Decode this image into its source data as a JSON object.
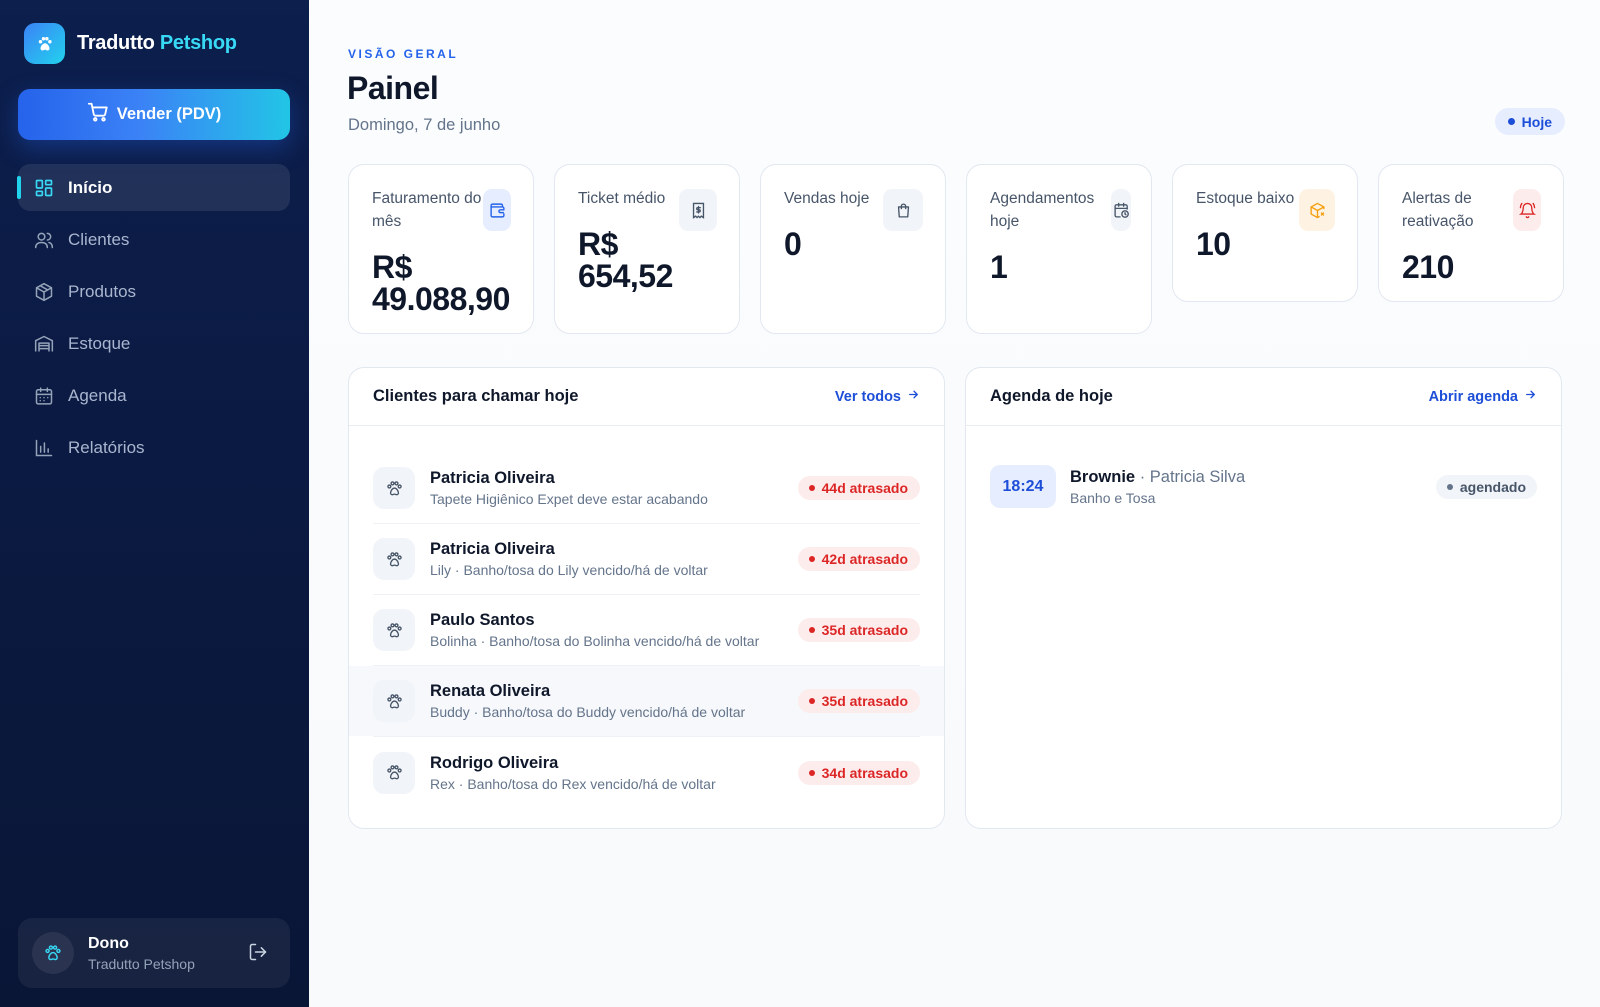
{
  "brand": {
    "name_prefix": "Tradutto",
    "name_accent": "Petshop",
    "logo_icon": "paw-icon"
  },
  "sidebar": {
    "pdv_button_label": "Vender (PDV)",
    "items": [
      {
        "label": "Início",
        "icon": "dashboard-icon",
        "active": true
      },
      {
        "label": "Clientes",
        "icon": "users-icon"
      },
      {
        "label": "Produtos",
        "icon": "box-icon"
      },
      {
        "label": "Estoque",
        "icon": "warehouse-icon"
      },
      {
        "label": "Agenda",
        "icon": "calendar-icon"
      },
      {
        "label": "Relatórios",
        "icon": "bar-chart-icon"
      }
    ],
    "user": {
      "name": "Dono",
      "subtitle": "Tradutto Petshop"
    }
  },
  "header": {
    "eyebrow": "VISÃO GERAL",
    "title": "Painel",
    "date": "Domingo, 7 de junho",
    "today_label": "Hoje"
  },
  "cards": [
    {
      "label": "Faturamento do mês",
      "value": "R$ 49.088,90",
      "icon": "wallet-icon",
      "color": "#2563eb"
    },
    {
      "label": "Ticket médio",
      "value": "R$ 654,52",
      "icon": "receipt-icon",
      "color": "#475569"
    },
    {
      "label": "Vendas hoje",
      "value": "0",
      "icon": "shopping-bag-icon",
      "color": "#475569"
    },
    {
      "label": "Agendamentos hoje",
      "value": "1",
      "icon": "calendar-clock-icon",
      "color": "#475569"
    },
    {
      "label": "Estoque baixo",
      "value": "10",
      "icon": "package-x-icon",
      "color": "#f59e0b"
    },
    {
      "label": "Alertas de reativação",
      "value": "210",
      "icon": "bell-icon",
      "color": "#dc2626"
    }
  ],
  "clients_panel": {
    "title": "Clientes para chamar hoje",
    "link": "Ver todos",
    "rows": [
      {
        "name": "Patricia Oliveira",
        "detail": "Tapete Higiênico Expet deve estar acabando",
        "badge": "44d atrasado"
      },
      {
        "name": "Patricia Oliveira",
        "detail": "Lily · Banho/tosa do Lily vencido/há de voltar",
        "badge": "42d atrasado"
      },
      {
        "name": "Paulo Santos",
        "detail": "Bolinha · Banho/tosa do Bolinha vencido/há de voltar",
        "badge": "35d atrasado"
      },
      {
        "name": "Renata Oliveira",
        "detail": "Buddy · Banho/tosa do Buddy vencido/há de voltar",
        "badge": "35d atrasado"
      },
      {
        "name": "Rodrigo Oliveira",
        "detail": "Rex · Banho/tosa do Rex vencido/há de voltar",
        "badge": "34d atrasado"
      }
    ]
  },
  "agenda_panel": {
    "title": "Agenda de hoje",
    "link": "Abrir agenda",
    "items": [
      {
        "time": "18:24",
        "pet": "Brownie",
        "owner": "· Patricia Silva",
        "service": "Banho e Tosa",
        "status": "agendado"
      }
    ]
  }
}
